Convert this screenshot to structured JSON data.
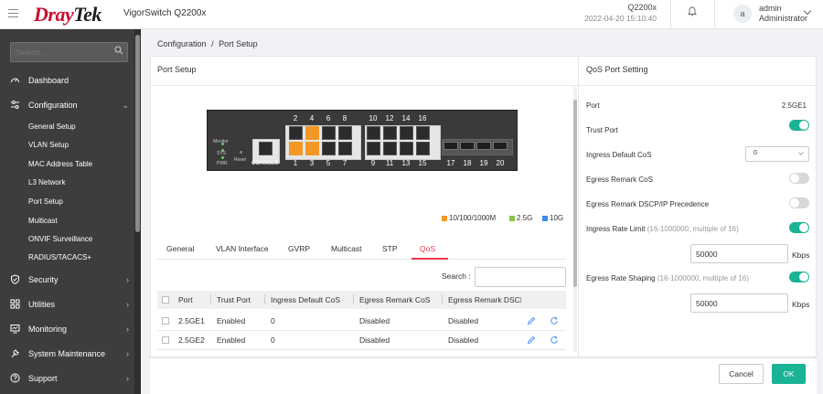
{
  "header": {
    "brand_red": "Dray",
    "brand_dark": "Tek",
    "model": "VigorSwitch Q2200x",
    "device_name": "Q2200x",
    "device_time": "2022-04-20 15:10:40",
    "avatar_letter": "a",
    "user_name": "admin",
    "user_role": "Administrator"
  },
  "sidebar": {
    "search_placeholder": "Search...",
    "items": [
      {
        "label": "Dashboard",
        "icon": "speedometer-icon"
      },
      {
        "label": "Configuration",
        "icon": "sliders-icon",
        "expanded": true
      },
      {
        "label": "Security",
        "icon": "shield-icon"
      },
      {
        "label": "Utilities",
        "icon": "grid-icon"
      },
      {
        "label": "Monitoring",
        "icon": "monitor-icon"
      },
      {
        "label": "System Maintenance",
        "icon": "wrench-icon"
      },
      {
        "label": "Support",
        "icon": "help-circle-icon"
      }
    ],
    "config_subitems": [
      "General Setup",
      "VLAN Setup",
      "MAC Address Table",
      "L3 Network",
      "Port Setup",
      "Multicast",
      "ONVIF Surveillance",
      "RADIUS/TACACS+"
    ]
  },
  "breadcrumb": {
    "parent": "Configuration",
    "separator": "/",
    "current": "Port Setup"
  },
  "port_setup": {
    "title": "Port Setup",
    "console_label": "CONSOLE",
    "led_labels": [
      "Monitor",
      "SYS",
      "PWR"
    ],
    "reset_label": "Reset",
    "top_numbers": [
      "2",
      "4",
      "6",
      "8",
      "10",
      "12",
      "14",
      "16"
    ],
    "bottom_numbers": [
      "1",
      "3",
      "5",
      "7",
      "9",
      "11",
      "13",
      "15",
      "17",
      "18",
      "19",
      "20"
    ],
    "legend": [
      {
        "label": "10/100/1000M",
        "color": "#f39826"
      },
      {
        "label": "2.5G",
        "color": "#8bc34a"
      },
      {
        "label": "10G",
        "color": "#3d8af7"
      }
    ],
    "tabs": [
      "General",
      "VLAN Interface",
      "GVRP",
      "Multicast",
      "STP",
      "QoS"
    ],
    "active_tab": "QoS",
    "search_label": "Search :",
    "search_value": "",
    "columns": [
      "Port",
      "Trust Port",
      "Ingress Default CoS",
      "Egress Remark CoS",
      "Egress Remark DSCP"
    ],
    "rows": [
      {
        "port": "2.5GE1",
        "trust": "Enabled",
        "cos": "0",
        "remark_cos": "Disabled",
        "remark_dscp": "Disabled"
      },
      {
        "port": "2.5GE2",
        "trust": "Enabled",
        "cos": "0",
        "remark_cos": "Disabled",
        "remark_dscp": "Disabled"
      }
    ]
  },
  "qos_setting": {
    "title": "QoS Port Setting",
    "port_label": "Port",
    "port_value": "2.5GE1",
    "trust_label": "Trust Port",
    "trust_on": true,
    "ingress_cos_label": "Ingress Default CoS",
    "ingress_cos_value": "0",
    "egress_cos_label": "Egress Remark CoS",
    "egress_cos_on": false,
    "egress_dscp_label": "Egress Remark DSCP/IP Precedence",
    "egress_dscp_on": false,
    "ingress_rate_label": "Ingress Rate Limit",
    "ingress_rate_hint": "(16-1000000, multiple of 16)",
    "ingress_rate_on": true,
    "ingress_rate_value": "50000",
    "egress_rate_label": "Egress Rate Shaping",
    "egress_rate_hint": "(16-1000000, multiple of 16)",
    "egress_rate_on": true,
    "egress_rate_value": "50000",
    "unit": "Kbps"
  },
  "footer": {
    "cancel_label": "Cancel",
    "ok_label": "OK"
  },
  "colors": {
    "accent": "#1ab394",
    "brand": "#c8102e",
    "active_tab": "#e8394b",
    "port_active": "#f39826"
  }
}
